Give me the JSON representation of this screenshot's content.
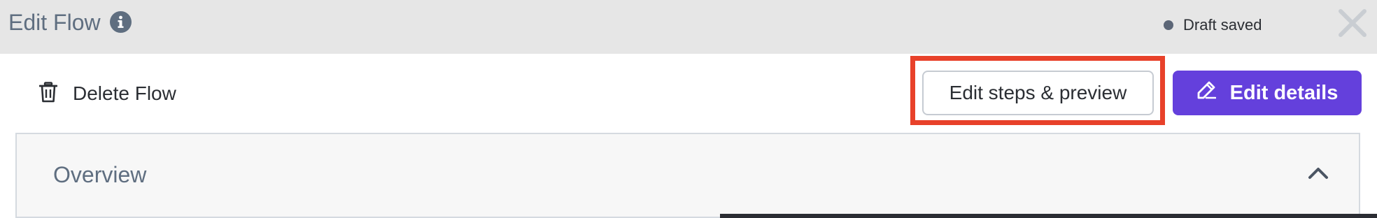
{
  "header": {
    "title": "Edit Flow",
    "info_icon": "info-icon",
    "status_text": "Draft saved",
    "status_dot_color": "#5c6677",
    "close_icon": "close-icon"
  },
  "toolbar": {
    "delete_label": "Delete Flow",
    "delete_icon": "trash-icon",
    "edit_steps_label": "Edit steps & preview",
    "edit_details_label": "Edit details",
    "edit_details_icon": "pencil-icon",
    "accent_color": "#6440dc",
    "highlight_color": "#e8412a"
  },
  "overview": {
    "title": "Overview",
    "toggle_icon": "chevron-up-icon"
  }
}
